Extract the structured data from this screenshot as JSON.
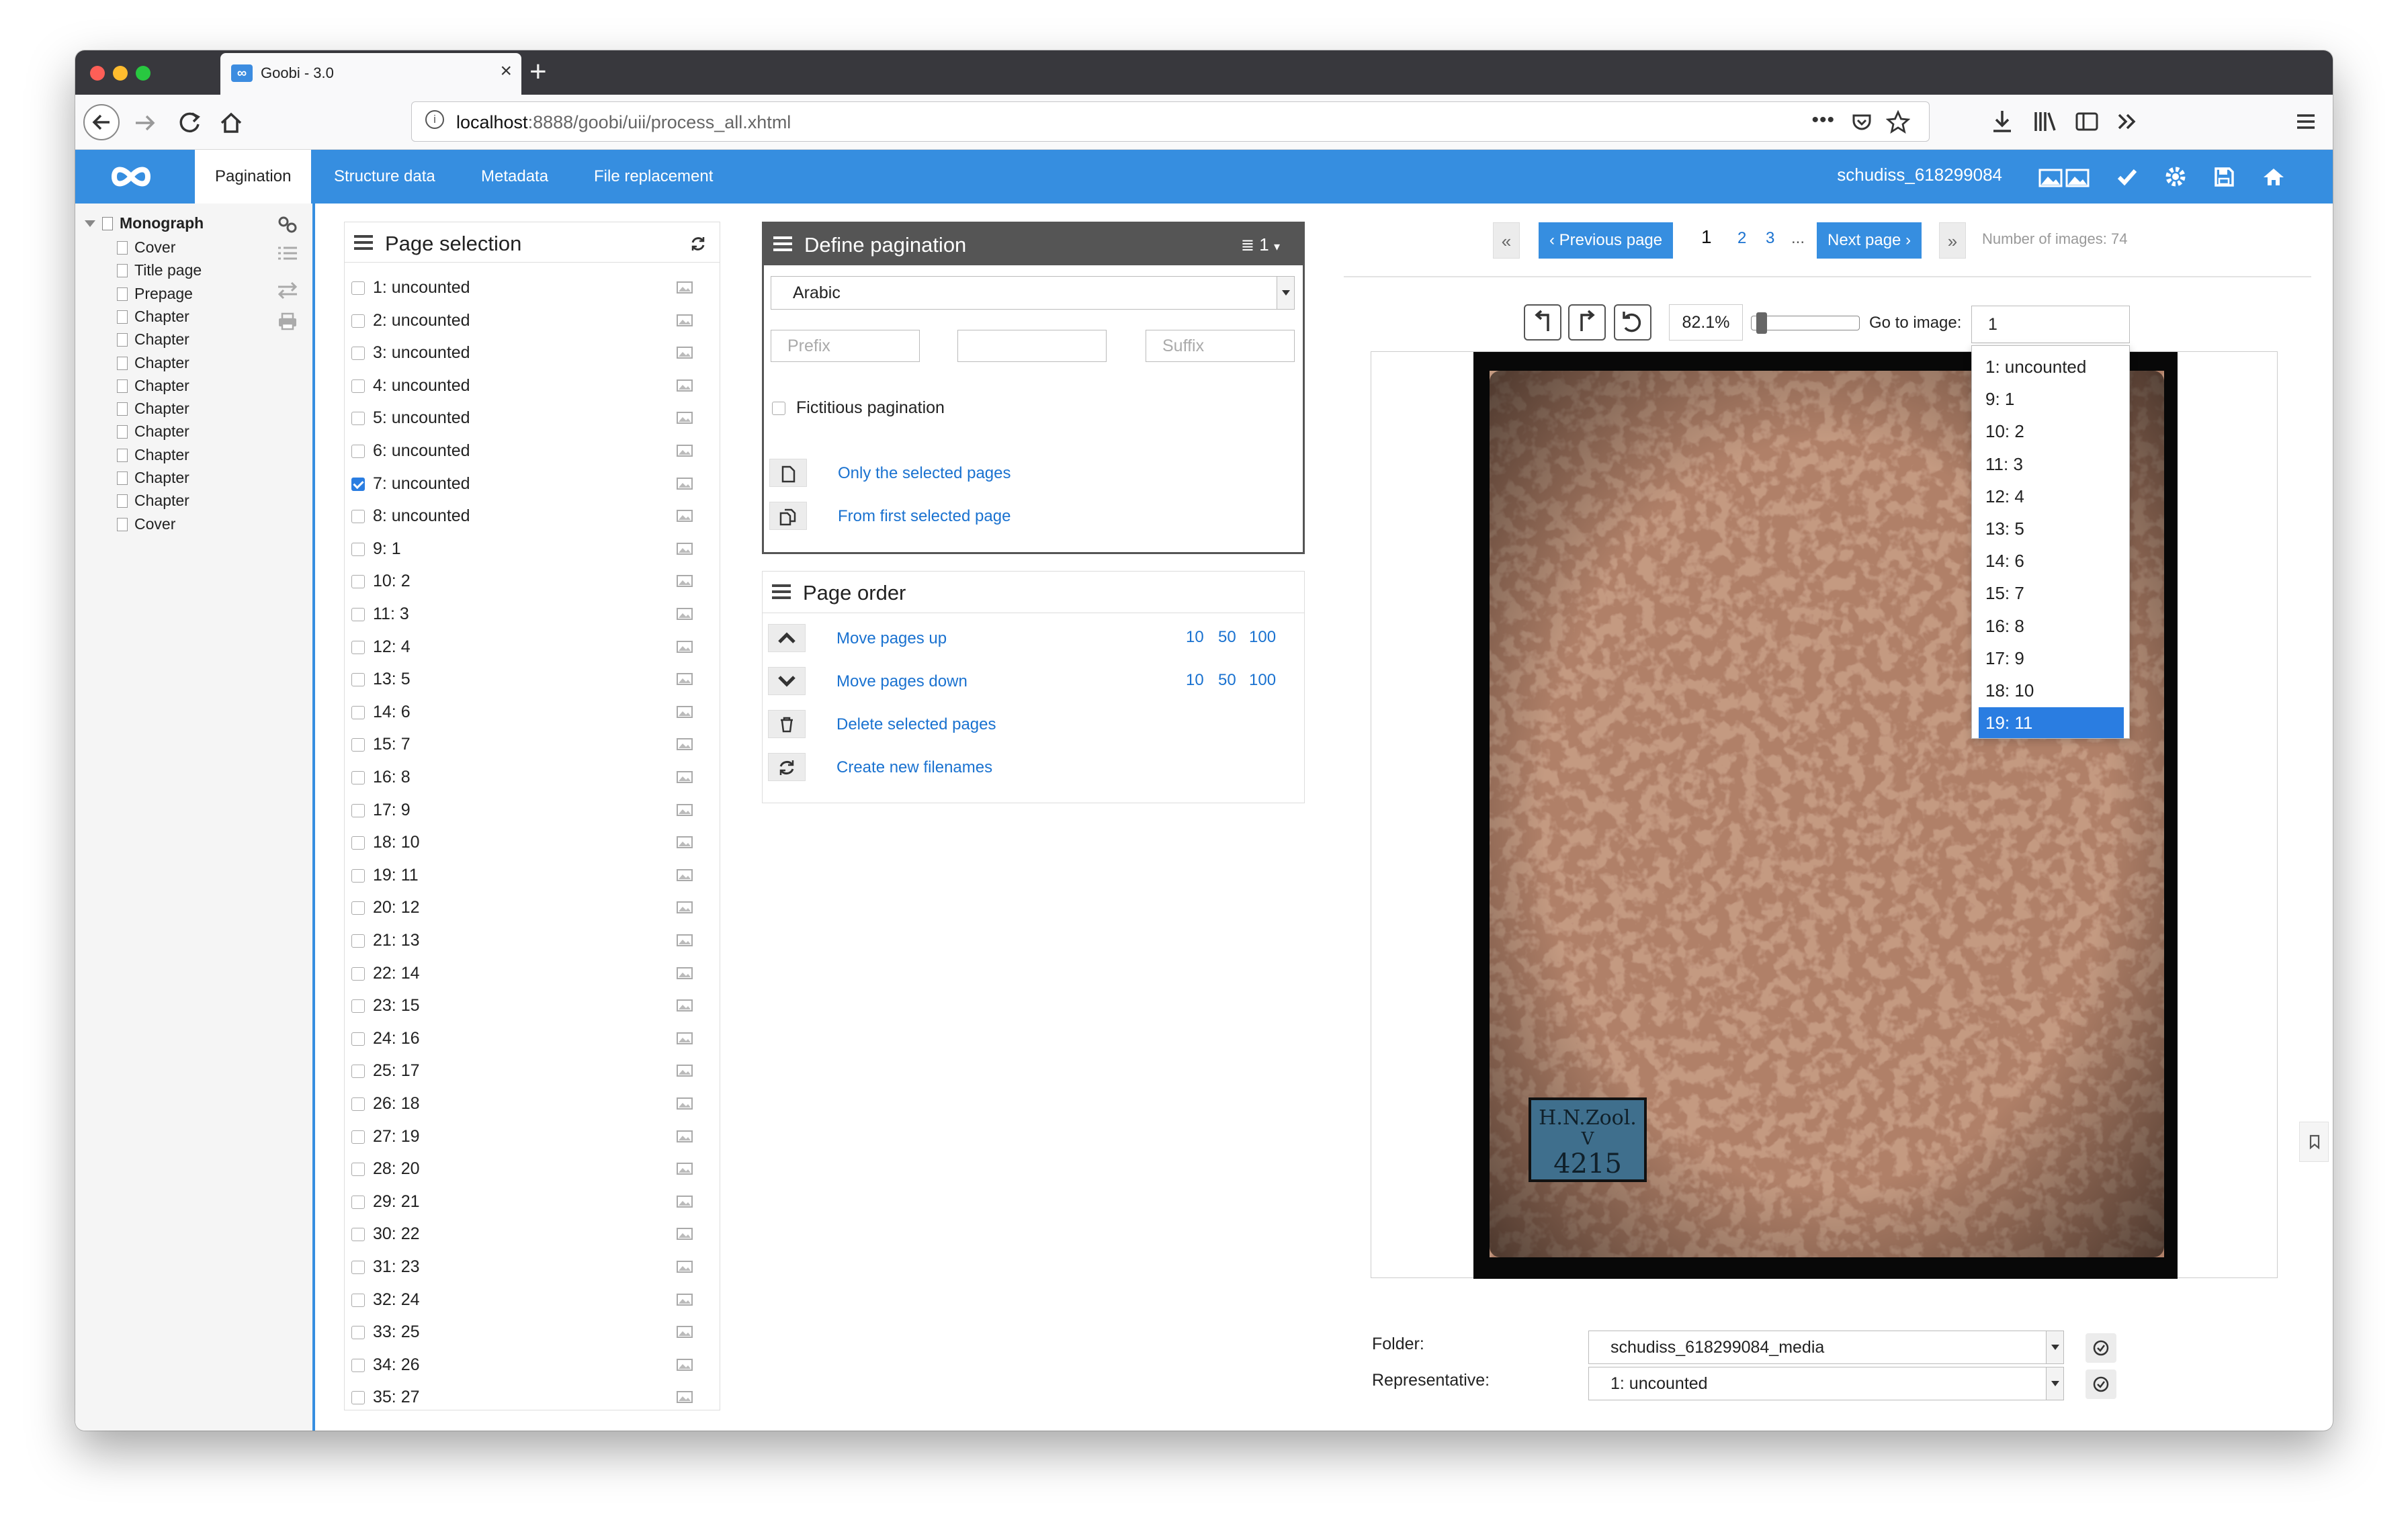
{
  "browser": {
    "tab_title": "Goobi - 3.0",
    "tab_favicon": "∞",
    "new_tab": "+",
    "url_host": "localhost",
    "url_rest": ":8888/goobi/uii/process_all.xhtml",
    "url_actions": "•••"
  },
  "app": {
    "tabs": [
      "Pagination",
      "Structure data",
      "Metadata",
      "File replacement"
    ],
    "active_tab": "Pagination",
    "process_id": "schudiss_618299084",
    "accent": "#368ee0"
  },
  "structure_tree": {
    "root": "Monograph",
    "items": [
      "Cover",
      "Title page",
      "Prepage",
      "Chapter",
      "Chapter",
      "Chapter",
      "Chapter",
      "Chapter",
      "Chapter",
      "Chapter",
      "Chapter",
      "Chapter",
      "Cover"
    ]
  },
  "page_selection": {
    "title": "Page selection",
    "pages": [
      {
        "label": "1: uncounted",
        "checked": false
      },
      {
        "label": "2: uncounted",
        "checked": false
      },
      {
        "label": "3: uncounted",
        "checked": false
      },
      {
        "label": "4: uncounted",
        "checked": false
      },
      {
        "label": "5: uncounted",
        "checked": false
      },
      {
        "label": "6: uncounted",
        "checked": false
      },
      {
        "label": "7: uncounted",
        "checked": true
      },
      {
        "label": "8: uncounted",
        "checked": false
      },
      {
        "label": "9: 1",
        "checked": false
      },
      {
        "label": "10: 2",
        "checked": false
      },
      {
        "label": "11: 3",
        "checked": false
      },
      {
        "label": "12: 4",
        "checked": false
      },
      {
        "label": "13: 5",
        "checked": false
      },
      {
        "label": "14: 6",
        "checked": false
      },
      {
        "label": "15: 7",
        "checked": false
      },
      {
        "label": "16: 8",
        "checked": false
      },
      {
        "label": "17: 9",
        "checked": false
      },
      {
        "label": "18: 10",
        "checked": false
      },
      {
        "label": "19: 11",
        "checked": false
      },
      {
        "label": "20: 12",
        "checked": false
      },
      {
        "label": "21: 13",
        "checked": false
      },
      {
        "label": "22: 14",
        "checked": false
      },
      {
        "label": "23: 15",
        "checked": false
      },
      {
        "label": "24: 16",
        "checked": false
      },
      {
        "label": "25: 17",
        "checked": false
      },
      {
        "label": "26: 18",
        "checked": false
      },
      {
        "label": "27: 19",
        "checked": false
      },
      {
        "label": "28: 20",
        "checked": false
      },
      {
        "label": "29: 21",
        "checked": false
      },
      {
        "label": "30: 22",
        "checked": false
      },
      {
        "label": "31: 23",
        "checked": false
      },
      {
        "label": "32: 24",
        "checked": false
      },
      {
        "label": "33: 25",
        "checked": false
      },
      {
        "label": "34: 26",
        "checked": false
      },
      {
        "label": "35: 27",
        "checked": false
      }
    ]
  },
  "define_pagination": {
    "title": "Define pagination",
    "menu_value": "1",
    "type_value": "Arabic",
    "prefix_placeholder": "Prefix",
    "middle_value": "",
    "suffix_placeholder": "Suffix",
    "fictitious_label": "Fictitious pagination",
    "only_selected": "Only the selected pages",
    "from_first": "From first selected page"
  },
  "page_order": {
    "title": "Page order",
    "move_up": "Move pages up",
    "move_down": "Move pages down",
    "delete": "Delete selected pages",
    "new_filenames": "Create new filenames",
    "steps": [
      "10",
      "50",
      "100"
    ]
  },
  "viewer": {
    "prev": "Previous page",
    "next": "Next page",
    "pages": [
      "1",
      "2",
      "3",
      "..."
    ],
    "current_page": "1",
    "image_count": "Number of images: 74",
    "zoom": "82.1%",
    "zoom_level": 0.05,
    "goto_label": "Go to image:",
    "goto_value": "1",
    "goto_options": [
      "1: uncounted",
      "9: 1",
      "10: 2",
      "11: 3",
      "12: 4",
      "13: 5",
      "14: 6",
      "15: 7",
      "16: 8",
      "17: 9",
      "18: 10",
      "19: 11"
    ],
    "goto_selected": "19: 11",
    "label_line1": "H.N.Zool.",
    "label_line2": "V",
    "label_line3": "4215",
    "folder_label": "Folder:",
    "folder_value": "schudiss_618299084_media",
    "representative_label": "Representative:",
    "representative_value": "1: uncounted"
  }
}
